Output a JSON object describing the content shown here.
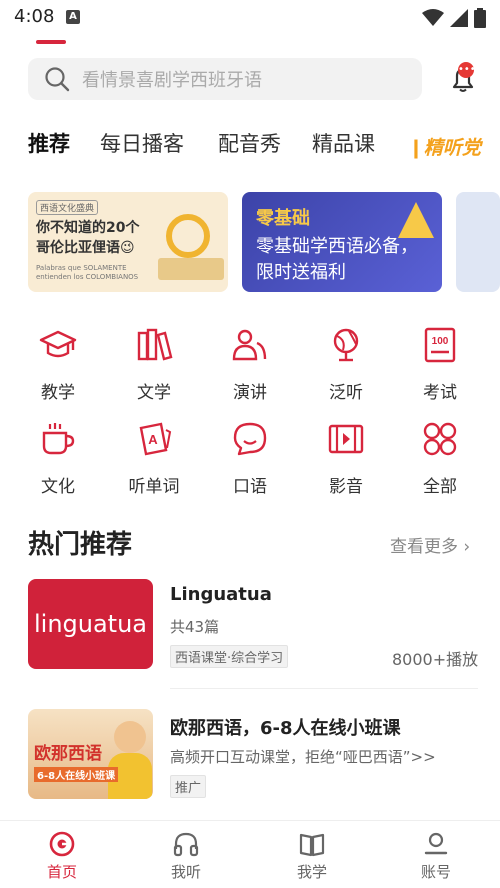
{
  "status_bar": {
    "time": "4:08",
    "app_icon_letter": "A"
  },
  "search": {
    "placeholder": "看情景喜剧学西班牙语"
  },
  "notifications": {
    "badge": ""
  },
  "tabs": [
    {
      "label": "推荐",
      "active": true
    },
    {
      "label": "每日播客"
    },
    {
      "label": "配音秀"
    },
    {
      "label": "精品课"
    },
    {
      "label": "精听党"
    }
  ],
  "banners": [
    {
      "tag": "西语文化盛典",
      "title_line1": "你不知道的20个",
      "title_line2": "哥伦比亚俚语😉",
      "subtitle": "Palabras que SOLAMENTE entienden los COLOMBIANOS"
    },
    {
      "line1": "零基础",
      "line2": "零基础学西语必备，",
      "line3": "限时送福利"
    }
  ],
  "categories": [
    {
      "label": "教学",
      "icon": "graduation-cap-icon"
    },
    {
      "label": "文学",
      "icon": "books-icon"
    },
    {
      "label": "演讲",
      "icon": "speaker-people-icon"
    },
    {
      "label": "泛听",
      "icon": "globe-icon"
    },
    {
      "label": "考试",
      "icon": "exam-100-icon"
    },
    {
      "label": "文化",
      "icon": "cup-icon"
    },
    {
      "label": "听单词",
      "icon": "word-card-icon"
    },
    {
      "label": "口语",
      "icon": "chat-bubble-icon"
    },
    {
      "label": "影音",
      "icon": "film-icon"
    },
    {
      "label": "全部",
      "icon": "grid-all-icon"
    }
  ],
  "section": {
    "title": "热门推荐",
    "more": "查看更多"
  },
  "list": [
    {
      "cover_text": "linguatua",
      "title": "Linguatua",
      "count": "共43篇",
      "tag": "西语课堂·综合学习",
      "plays": "8000+播放"
    },
    {
      "cover_title": "欧那西语",
      "cover_sub": "6-8人在线小班课",
      "title": "欧那西语，6-8人在线小班课",
      "desc": "高频开口互动课堂，拒绝“哑巴西语”>>",
      "tag": "推广"
    }
  ],
  "bottom_nav": [
    {
      "label": "首页",
      "active": true
    },
    {
      "label": "我听"
    },
    {
      "label": "我学"
    },
    {
      "label": "账号"
    }
  ],
  "colors": {
    "accent": "#d7263d",
    "highlight": "#f4a11c"
  }
}
